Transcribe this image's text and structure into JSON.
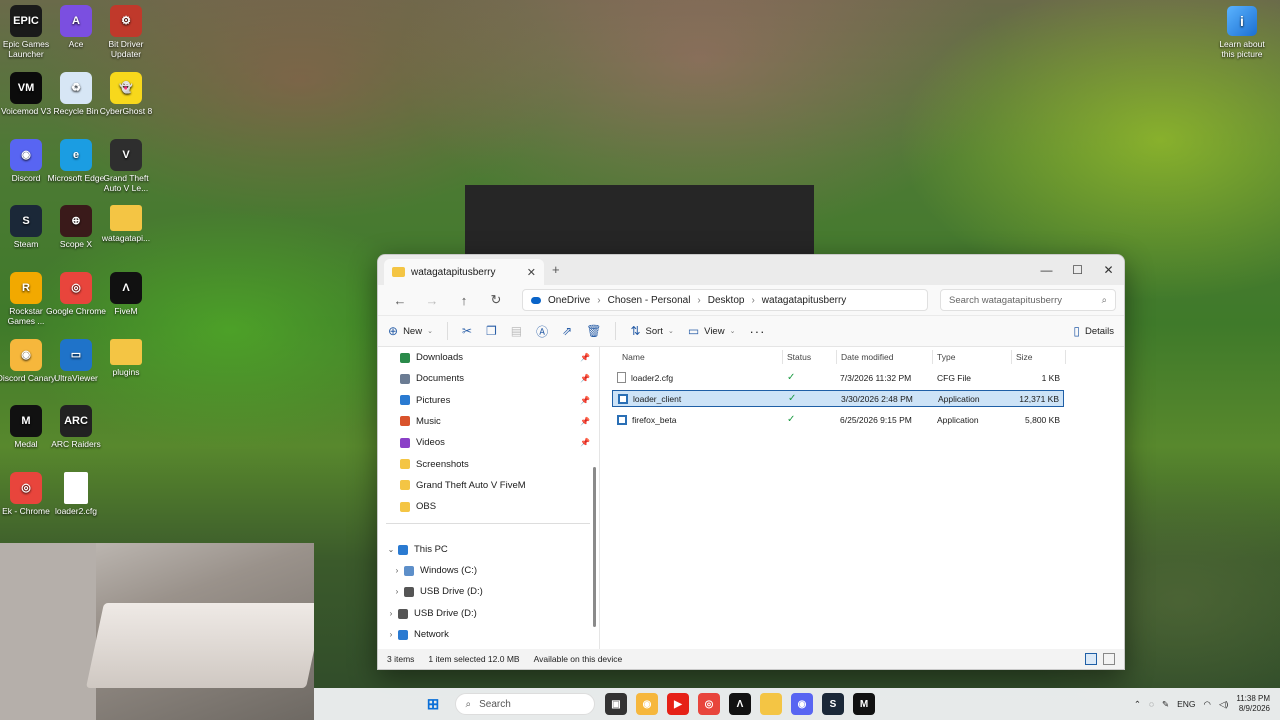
{
  "desktop": {
    "icons": [
      {
        "label": "Epic Games Launcher",
        "icon": "epic-games-icon",
        "color": "#1a1a1a",
        "glyph": "EPIC"
      },
      {
        "label": "Ace",
        "icon": "ace-icon",
        "color": "#7b4fe0",
        "glyph": "A"
      },
      {
        "label": "Bit Driver Updater",
        "icon": "gear-icon",
        "color": "#c0392b",
        "glyph": "⚙"
      },
      {
        "label": "Voicemod V3",
        "icon": "voicemod-icon",
        "color": "#0b0b0b",
        "glyph": "VM"
      },
      {
        "label": "Recycle Bin",
        "icon": "recycle-bin-icon",
        "color": "#d7e6f5",
        "glyph": "♻"
      },
      {
        "label": "CyberGhost 8",
        "icon": "cyberghost-icon",
        "color": "#f7d81c",
        "glyph": "👻"
      },
      {
        "label": "Discord",
        "icon": "discord-icon",
        "color": "#5865f2",
        "glyph": "◉"
      },
      {
        "label": "Microsoft Edge",
        "icon": "edge-icon",
        "color": "#1b9de2",
        "glyph": "e"
      },
      {
        "label": "Grand Theft Auto V Le...",
        "icon": "gta-icon",
        "color": "#2e2e2e",
        "glyph": "V"
      },
      {
        "label": "Steam",
        "icon": "steam-icon",
        "color": "#1b2838",
        "glyph": "S"
      },
      {
        "label": "Scope X",
        "icon": "crosshair-icon",
        "color": "#3a1a1a",
        "glyph": "⊕"
      },
      {
        "label": "watagatapi...",
        "icon": "folder-icon",
        "color": "#f4c544",
        "glyph": ""
      },
      {
        "label": "Rockstar Games ...",
        "icon": "rockstar-icon",
        "color": "#f2a900",
        "glyph": "R"
      },
      {
        "label": "Google Chrome",
        "icon": "chrome-icon",
        "color": "#e8453c",
        "glyph": "◎"
      },
      {
        "label": "FiveM",
        "icon": "fivem-icon",
        "color": "#111",
        "glyph": "Λ"
      },
      {
        "label": "Discord Canary",
        "icon": "discord-canary-icon",
        "color": "#f6b73c",
        "glyph": "◉"
      },
      {
        "label": "UltraViewer",
        "icon": "ultraviewer-icon",
        "color": "#1f73c9",
        "glyph": "▭"
      },
      {
        "label": "plugins",
        "icon": "folder-icon",
        "color": "#f4c544",
        "glyph": ""
      },
      {
        "label": "Medal",
        "icon": "medal-icon",
        "color": "#111",
        "glyph": "M"
      },
      {
        "label": "ARC Raiders",
        "icon": "arc-raiders-icon",
        "color": "#222",
        "glyph": "ARC"
      },
      {
        "label": "",
        "icon": "empty",
        "color": "transparent",
        "glyph": ""
      },
      {
        "label": "Ek - Chrome",
        "icon": "chrome-icon",
        "color": "#e8453c",
        "glyph": "◎"
      },
      {
        "label": "loader2.cfg",
        "icon": "file-icon",
        "color": "#ffffff",
        "glyph": ""
      }
    ],
    "spotlight_label": "Learn about this picture"
  },
  "explorer": {
    "tab_title": "watagatapitusberry",
    "breadcrumb": [
      "OneDrive",
      "Chosen - Personal",
      "Desktop",
      "watagatapitusberry"
    ],
    "search_placeholder": "Search watagatapitusberry",
    "toolbar": {
      "new": "New",
      "sort": "Sort",
      "view": "View",
      "details": "Details"
    },
    "nav": [
      {
        "label": "Downloads",
        "color": "#2a8a4a",
        "pinned": true
      },
      {
        "label": "Documents",
        "color": "#6b7c93",
        "pinned": true
      },
      {
        "label": "Pictures",
        "color": "#2a7ad1",
        "pinned": true
      },
      {
        "label": "Music",
        "color": "#d9532c",
        "pinned": true
      },
      {
        "label": "Videos",
        "color": "#8a3fc7",
        "pinned": true
      },
      {
        "label": "Screenshots",
        "color": "#f4c544",
        "pinned": false
      },
      {
        "label": "Grand Theft Auto V FiveM",
        "color": "#f4c544",
        "pinned": false
      },
      {
        "label": "OBS",
        "color": "#f4c544",
        "pinned": false
      }
    ],
    "tree": [
      {
        "label": "This PC",
        "color": "#2a7ad1"
      },
      {
        "label": "Windows (C:)",
        "color": "#5d8fc9"
      },
      {
        "label": "USB Drive (D:)",
        "color": "#555"
      },
      {
        "label": "USB Drive (D:)",
        "color": "#555"
      },
      {
        "label": "Network",
        "color": "#2a7ad1"
      }
    ],
    "columns": [
      "Name",
      "Status",
      "Date modified",
      "Type",
      "Size"
    ],
    "files": [
      {
        "name": "loader2.cfg",
        "status": "✓",
        "date": "7/3/2026 11:32 PM",
        "type": "CFG File",
        "size": "1 KB"
      },
      {
        "name": "loader_client",
        "status": "✓",
        "date": "3/30/2026 2:48 PM",
        "type": "Application",
        "size": "12,371 KB"
      },
      {
        "name": "firefox_beta",
        "status": "✓",
        "date": "6/25/2026 9:15 PM",
        "type": "Application",
        "size": "5,800 KB"
      }
    ],
    "status": {
      "count": "3 items",
      "selected": "1 item selected  12.0 MB",
      "availability": "Available on this device"
    }
  },
  "taskbar": {
    "search_label": "Search",
    "lang": "ENG",
    "time": "11:38 PM",
    "date": "8/9/2026"
  }
}
